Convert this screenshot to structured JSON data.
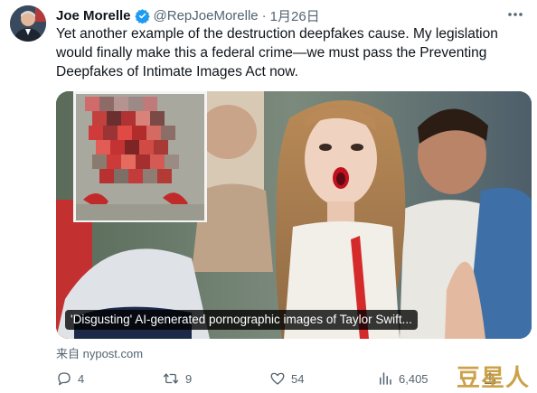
{
  "tweet": {
    "author_name": "Joe Morelle",
    "handle": "@RepJoeMorelle",
    "separator": "·",
    "date": "1月26日",
    "text_lines": [
      "Yet another example of the destruction deepfakes cause. My legislation",
      "would finally make this a federal crime—we must pass the Preventing",
      "Deepfakes of Intimate Images Act now."
    ],
    "media_caption": "'Disgusting' AI-generated pornographic images of Taylor Swift...",
    "source": "来自 nypost.com"
  },
  "actions": {
    "replies": "4",
    "retweets": "9",
    "likes": "54",
    "views": "6,405"
  },
  "watermark": "豆星人",
  "colors": {
    "verified": "#1d9bf0",
    "text_primary": "#0f1419",
    "text_secondary": "#536471",
    "watermark": "#c89a3a"
  },
  "icons": [
    "verified-badge-icon",
    "more-icon",
    "reply-icon",
    "retweet-icon",
    "like-icon",
    "views-icon",
    "share-icon"
  ]
}
